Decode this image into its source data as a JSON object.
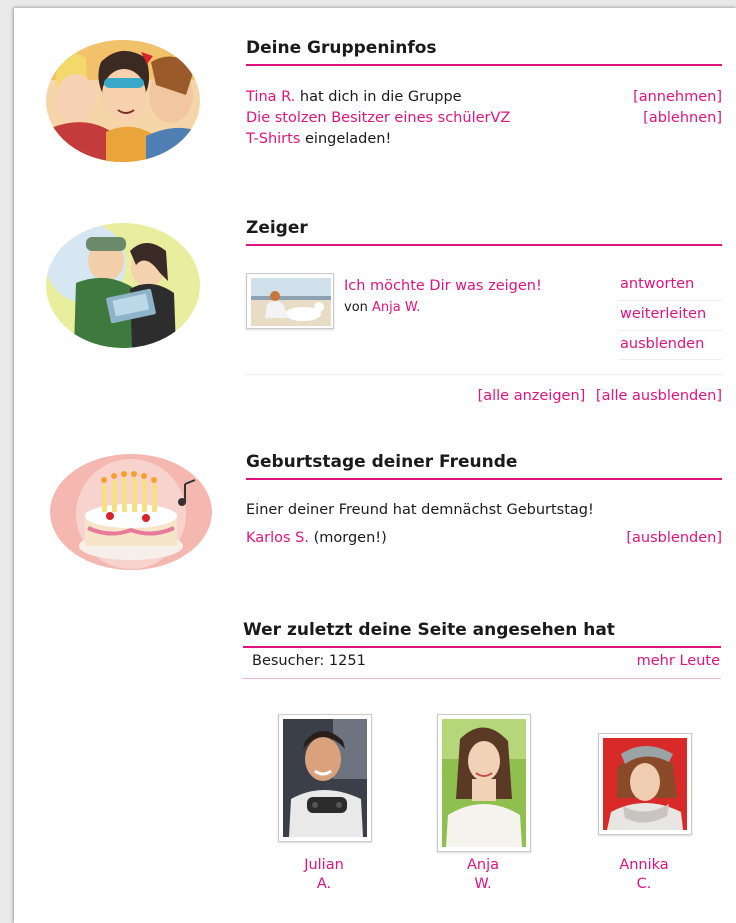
{
  "group_info": {
    "title": "Deine Gruppeninfos",
    "inviter": "Tina R.",
    "text_1": "hat dich in die Gruppe",
    "group_line_1": "Die stolzen Besitzer eines schülerVZ",
    "group_line_2": "T-Shirts",
    "text_2": "eingeladen!",
    "accept": "[annehmen]",
    "decline": "[ablehnen]"
  },
  "pointer": {
    "title": "Zeiger",
    "message": "Ich möchte Dir was zeigen!",
    "from_prefix": "von",
    "from_name": "Anja W.",
    "actions": [
      "antworten",
      "weiterleiten",
      "ausblenden"
    ],
    "show_all": "[alle anzeigen]",
    "hide_all": "[alle ausblenden]"
  },
  "birthdays": {
    "title": "Geburtstage deiner Freunde",
    "text": "Einer deiner Freund hat demnächst Geburtstag!",
    "friend": "Karlos S.",
    "when": "(morgen!)",
    "hide": "[ausblenden]"
  },
  "visitors": {
    "title": "Wer zuletzt deine Seite angesehen hat",
    "count_label": "Besucher: 1251",
    "more": "mehr Leute",
    "people": [
      {
        "first": "Julian",
        "last": "A."
      },
      {
        "first": "Anja",
        "last": "W."
      },
      {
        "first": "Annika",
        "last": "C."
      }
    ]
  },
  "colors": {
    "accent": "#e0137f",
    "text": "#1a1a1a",
    "background": "#ffffff"
  }
}
